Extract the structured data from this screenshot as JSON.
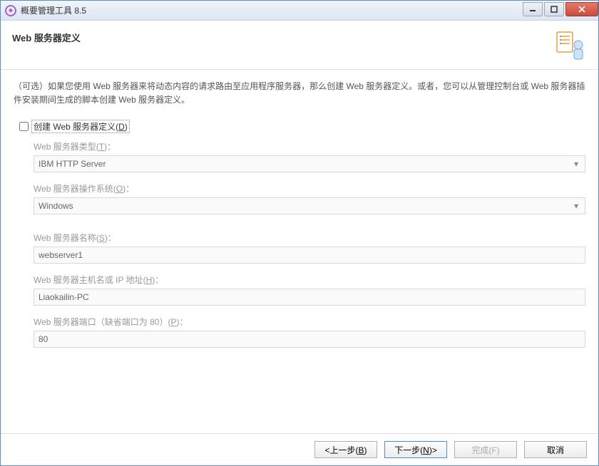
{
  "titlebar": {
    "text": "概要管理工具 8.5"
  },
  "header": {
    "title": "Web 服务器定义"
  },
  "description": "（可选）如果您使用 Web 服务器来将动态内容的请求路由至应用程序服务器，那么创建 Web 服务器定义。或者，您可以从管理控制台或 Web 服务器插件安装期间生成的脚本创建 Web 服务器定义。",
  "checkbox": {
    "label_pre": "创建 Web 服务器定义(",
    "mn": "D",
    "label_post": ")"
  },
  "fields": {
    "type": {
      "label_pre": "Web 服务器类型(",
      "mn": "T",
      "label_post": ")：",
      "value": "IBM HTTP Server"
    },
    "os": {
      "label_pre": "Web 服务器操作系统(",
      "mn": "O",
      "label_post": ")：",
      "value": "Windows"
    },
    "name": {
      "label_pre": "Web 服务器名称(",
      "mn": "S",
      "label_post": ")：",
      "value": "webserver1"
    },
    "host": {
      "label_pre": "Web 服务器主机名或 IP 地址(",
      "mn": "H",
      "label_post": ")：",
      "value": "Liaokailin-PC"
    },
    "port": {
      "label_pre": "Web 服务器端口（缺省端口为 80）(",
      "mn": "P",
      "label_post": ")：",
      "value": "80"
    }
  },
  "buttons": {
    "back": {
      "pre": "<上一步(",
      "mn": "B",
      "post": ")"
    },
    "next": {
      "pre": "下一步(",
      "mn": "N",
      "post": ")>"
    },
    "finish": {
      "pre": "完成(",
      "mn": "F",
      "post": ")"
    },
    "cancel": {
      "text": "取消"
    }
  }
}
